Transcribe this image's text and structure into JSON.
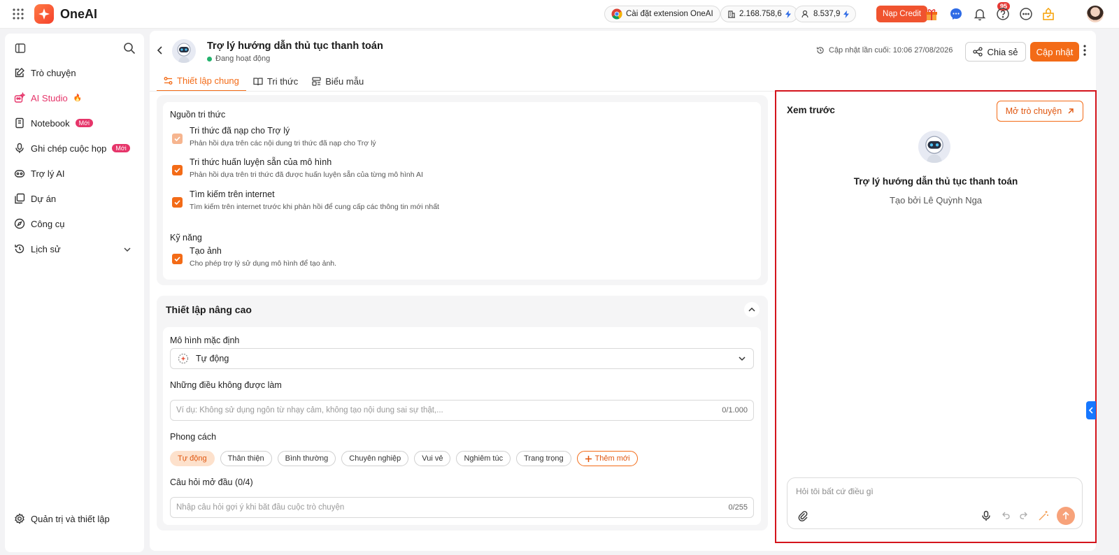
{
  "app": {
    "brand": "OneAI"
  },
  "topbar": {
    "extension_label": "Cài đặt extension OneAI",
    "credit_balance": "2.168.758,6",
    "personal_balance": "8.537,9",
    "topup_label": "Nạp Credit",
    "notification_count": "95"
  },
  "sidebar": {
    "items": [
      {
        "label": "Trò chuyện",
        "icon": "chat-edit-icon"
      },
      {
        "label": "AI Studio",
        "icon": "studio-icon",
        "extra": "🔥"
      },
      {
        "label": "Notebook",
        "icon": "notebook-icon",
        "badge": "Mới"
      },
      {
        "label": "Ghi chép cuộc họp",
        "icon": "mic-icon",
        "badge": "Mới"
      },
      {
        "label": "Trợ lý AI",
        "icon": "bot-icon"
      },
      {
        "label": "Dự án",
        "icon": "project-icon"
      },
      {
        "label": "Công cụ",
        "icon": "tool-icon"
      },
      {
        "label": "Lịch sử",
        "icon": "history-icon"
      }
    ],
    "footer_label": "Quản trị và thiết lập"
  },
  "header": {
    "title": "Trợ lý hướng dẫn thủ tục thanh toán",
    "status": "Đang hoạt động",
    "last_updated": "Cập nhật lần cuối: 10:06 27/08/2026",
    "share_label": "Chia sẻ",
    "update_label": "Cập nhật"
  },
  "tabs": [
    {
      "label": "Thiết lập chung",
      "active": true
    },
    {
      "label": "Tri thức",
      "active": false
    },
    {
      "label": "Biểu mẫu",
      "active": false
    }
  ],
  "knowledge": {
    "section_label": "Nguồn tri thức",
    "options": [
      {
        "title": "Tri thức đã nạp cho Trợ lý",
        "desc": "Phản hồi dựa trên các nội dung tri thức đã nạp cho Trợ lý",
        "checked": true,
        "disabled": true
      },
      {
        "title": "Tri thức huấn luyện sẵn của mô hình",
        "desc": "Phản hồi dựa trên tri thức đã được huấn luyện sẵn của từng mô hình AI",
        "checked": true
      },
      {
        "title": "Tìm kiếm trên internet",
        "desc": "Tìm kiếm trên internet trước khi phản hồi để cung cấp các thông tin mới nhất",
        "checked": true
      }
    ],
    "skills_label": "Kỹ năng",
    "skill": {
      "title": "Tạo ảnh",
      "desc": "Cho phép trợ lý sử dụng mô hình để tạo ảnh.",
      "checked": true
    }
  },
  "advanced": {
    "title": "Thiết lập nâng cao",
    "model_label": "Mô hình mặc định",
    "model_value": "Tự động",
    "donts_label": "Những điều không được làm",
    "donts_placeholder": "Ví dụ: Không sử dụng ngôn từ nhạy cảm, không tạo nội dung sai sự thật,...",
    "donts_counter": "0/1.000",
    "style_label": "Phong cách",
    "styles": [
      "Tự động",
      "Thân thiện",
      "Bình thường",
      "Chuyên nghiệp",
      "Vui vẻ",
      "Nghiêm túc",
      "Trang trọng"
    ],
    "add_style_label": "Thêm mới",
    "opening_label": "Câu hỏi mở đầu (0/4)",
    "opening_placeholder": "Nhập câu hỏi gợi ý khi bắt đầu cuộc trò chuyện",
    "opening_counter": "0/255"
  },
  "preview": {
    "title": "Xem trước",
    "open_chat_label": "Mở trò chuyện",
    "assistant_name": "Trợ lý hướng dẫn thủ tục thanh toán",
    "created_by": "Tạo bởi Lê Quỳnh Nga",
    "chat_placeholder": "Hỏi tôi bất cứ điều gì"
  },
  "colors": {
    "accent": "#f36b17",
    "studio": "#e6356a",
    "highlight": "#d4141c"
  }
}
